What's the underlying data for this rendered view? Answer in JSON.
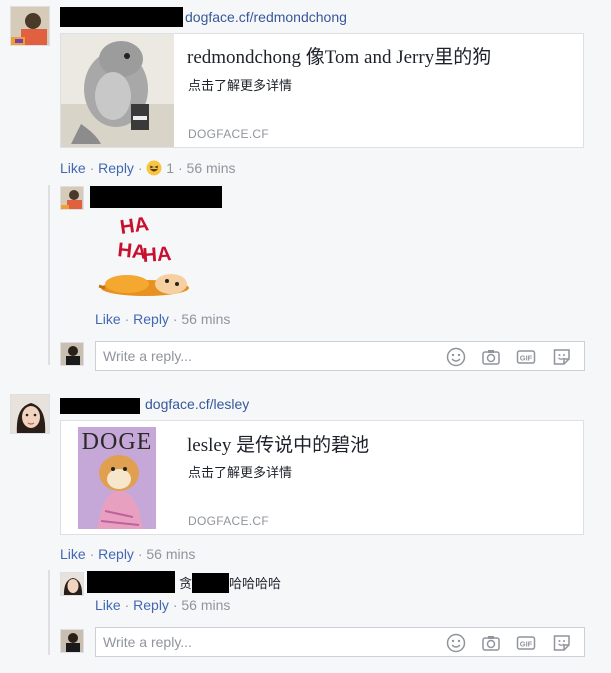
{
  "comments": [
    {
      "profile_link": "dogface.cf/redmondchong",
      "card": {
        "title": "redmondchong 像Tom and Jerry里的狗",
        "description": "点击了解更多详情",
        "domain": "DOGFACE.CF"
      },
      "actions": {
        "like": "Like",
        "reply": "Reply",
        "reaction_count": "1",
        "time": "56 mins"
      },
      "reply": {
        "sticker_text": [
          "HA",
          "HA",
          "HA"
        ],
        "actions": {
          "like": "Like",
          "reply": "Reply",
          "time": "56 mins"
        }
      },
      "reply_box": {
        "placeholder": "Write a reply..."
      }
    },
    {
      "profile_link": "dogface.cf/lesley",
      "card": {
        "title": "lesley 是传说中的碧池",
        "description": "点击了解更多详情",
        "domain": "DOGFACE.CF",
        "magazine_title": "DOGE"
      },
      "actions": {
        "like": "Like",
        "reply": "Reply",
        "time": "56 mins"
      },
      "reply": {
        "text_prefix": "贪",
        "text_suffix": "哈哈哈哈",
        "actions": {
          "like": "Like",
          "reply": "Reply",
          "time": "56 mins"
        }
      },
      "reply_box": {
        "placeholder": "Write a reply..."
      }
    }
  ],
  "separator": "·",
  "icons": [
    "laugh-reaction-icon",
    "emoji-icon",
    "camera-icon",
    "gif-icon",
    "sticker-icon"
  ],
  "colors": {
    "link": "#365899",
    "action": "#4267b2",
    "meta": "#90949c",
    "background": "#f6f7f9"
  }
}
